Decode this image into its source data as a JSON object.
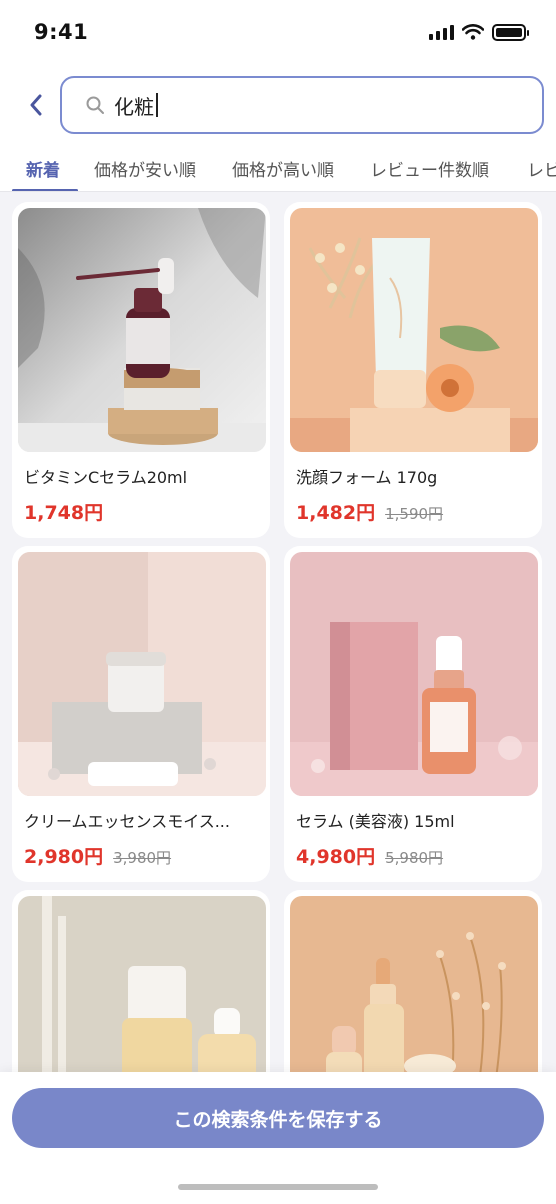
{
  "status": {
    "time": "9:41"
  },
  "search": {
    "query": "化粧"
  },
  "tabs": [
    {
      "label": "新着",
      "active": true
    },
    {
      "label": "価格が安い順"
    },
    {
      "label": "価格が高い順"
    },
    {
      "label": "レビュー件数順"
    },
    {
      "label": "レビ"
    }
  ],
  "products": [
    {
      "name": "ビタミンCセラム20ml",
      "price": "1,748円",
      "old_price": "",
      "image": "dropper-bottle-on-wood-image"
    },
    {
      "name": "洗顔フォーム 170g",
      "price": "1,482円",
      "old_price": "1,590円",
      "image": "cleansing-tube-with-flowers-image"
    },
    {
      "name": "クリームエッセンスモイス...",
      "price": "2,980円",
      "old_price": "3,980円",
      "image": "cream-jar-on-stone-image"
    },
    {
      "name": "セラム (美容液) 15ml",
      "price": "4,980円",
      "old_price": "5,980円",
      "image": "serum-bottle-with-box-image"
    },
    {
      "name": "",
      "price": "",
      "old_price": "",
      "image": "toner-bottles-image"
    },
    {
      "name": "",
      "price": "",
      "old_price": "",
      "image": "oil-bottles-with-flowers-image"
    }
  ],
  "footer": {
    "save_label": "この検索条件を保存する"
  },
  "colors": {
    "accent": "#5664b0",
    "price": "#e0352b",
    "save_button": "#7987c9",
    "search_border": "#7b8bd0"
  }
}
